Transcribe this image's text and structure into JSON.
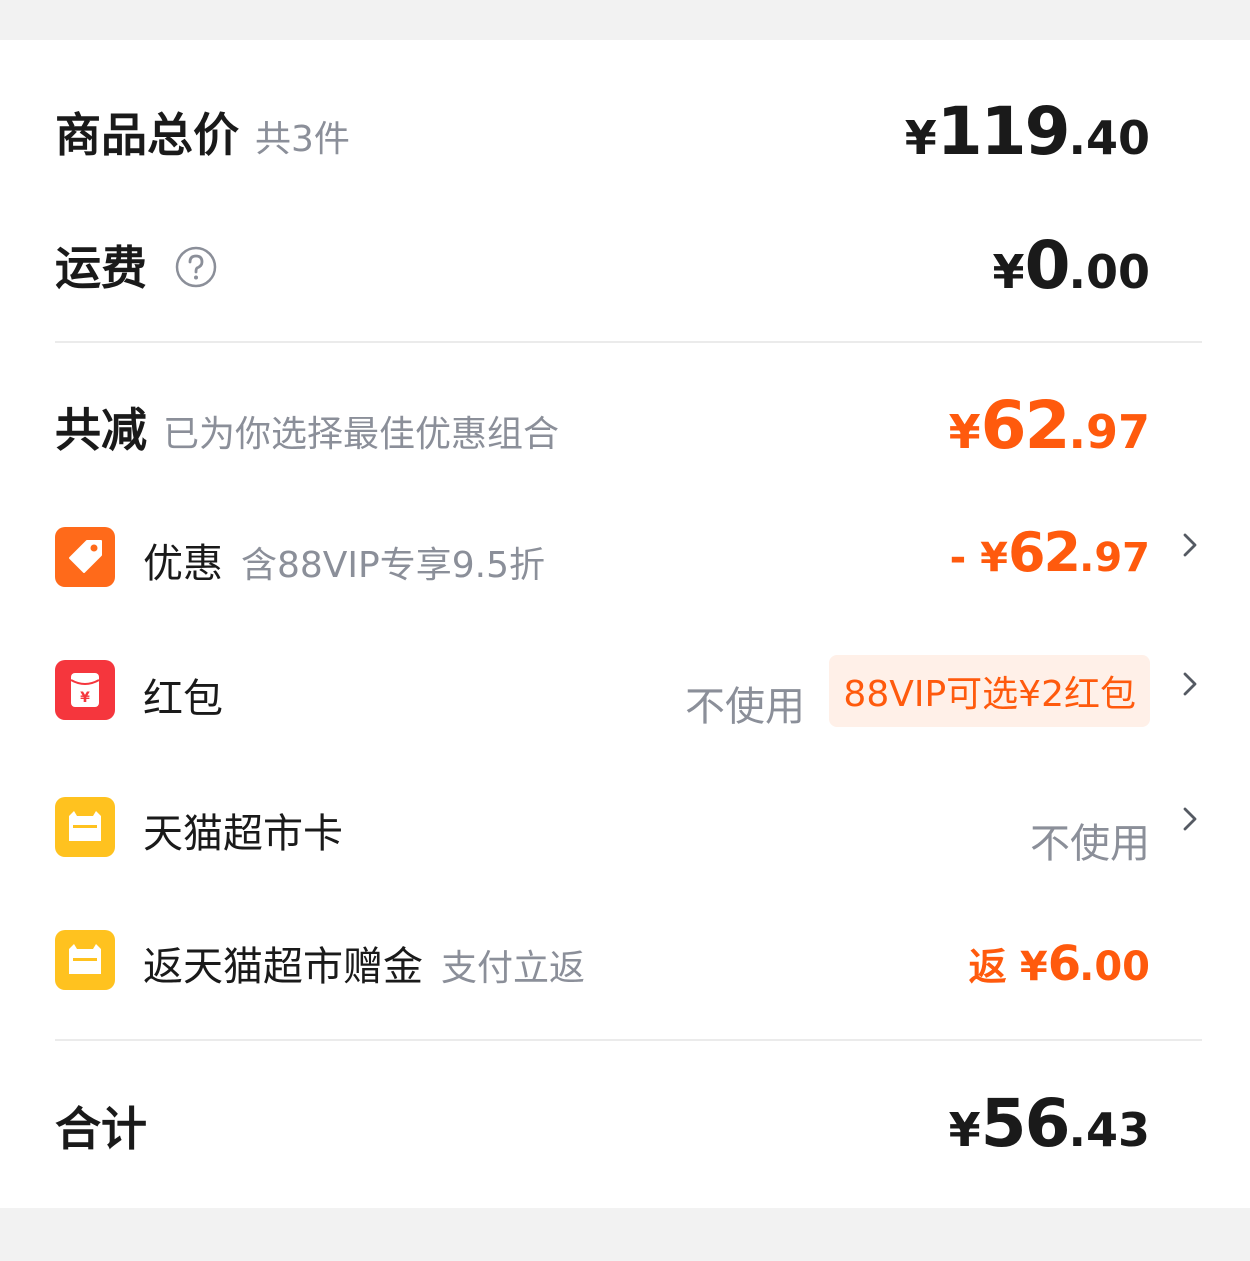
{
  "summary": {
    "total": {
      "label": "商品总价",
      "sub": "共3件",
      "currency": "¥",
      "int": "119",
      "dec": ".40"
    },
    "shipping": {
      "label": "运费",
      "currency": "¥",
      "int": "0",
      "dec": ".00",
      "help_icon": "question-circle-icon"
    },
    "discount": {
      "label": "共减",
      "sub": "已为你选择最佳优惠组合",
      "currency": "¥",
      "int": "62",
      "dec": ".97"
    }
  },
  "items": [
    {
      "label": "优惠",
      "sub": "含88VIP专享9.5折",
      "icon": "tag-icon",
      "prefix": "- ",
      "currency": "¥",
      "int": "62",
      "dec": ".97"
    },
    {
      "label": "红包",
      "icon": "red-envelope-icon",
      "value": "不使用",
      "tag": "88VIP可选¥2红包"
    },
    {
      "label": "天猫超市卡",
      "icon": "cat-card-icon",
      "value": "不使用"
    },
    {
      "label": "返天猫超市赠金",
      "sub": "支付立返",
      "icon": "cat-card-icon",
      "prefix": "返 ",
      "currency": "¥",
      "int": "6",
      "dec": ".00"
    }
  ],
  "footer": {
    "label": "合计",
    "currency": "¥",
    "int": "56",
    "dec": ".43"
  },
  "colors": {
    "accent": "#ff5a0d",
    "tag_icon_bg": "#ff6a1a",
    "red_packet_bg": "#f5363d",
    "card_icon_bg": "#ffc21f",
    "muted": "#8b8f99",
    "page_bg": "#f2f2f2"
  }
}
